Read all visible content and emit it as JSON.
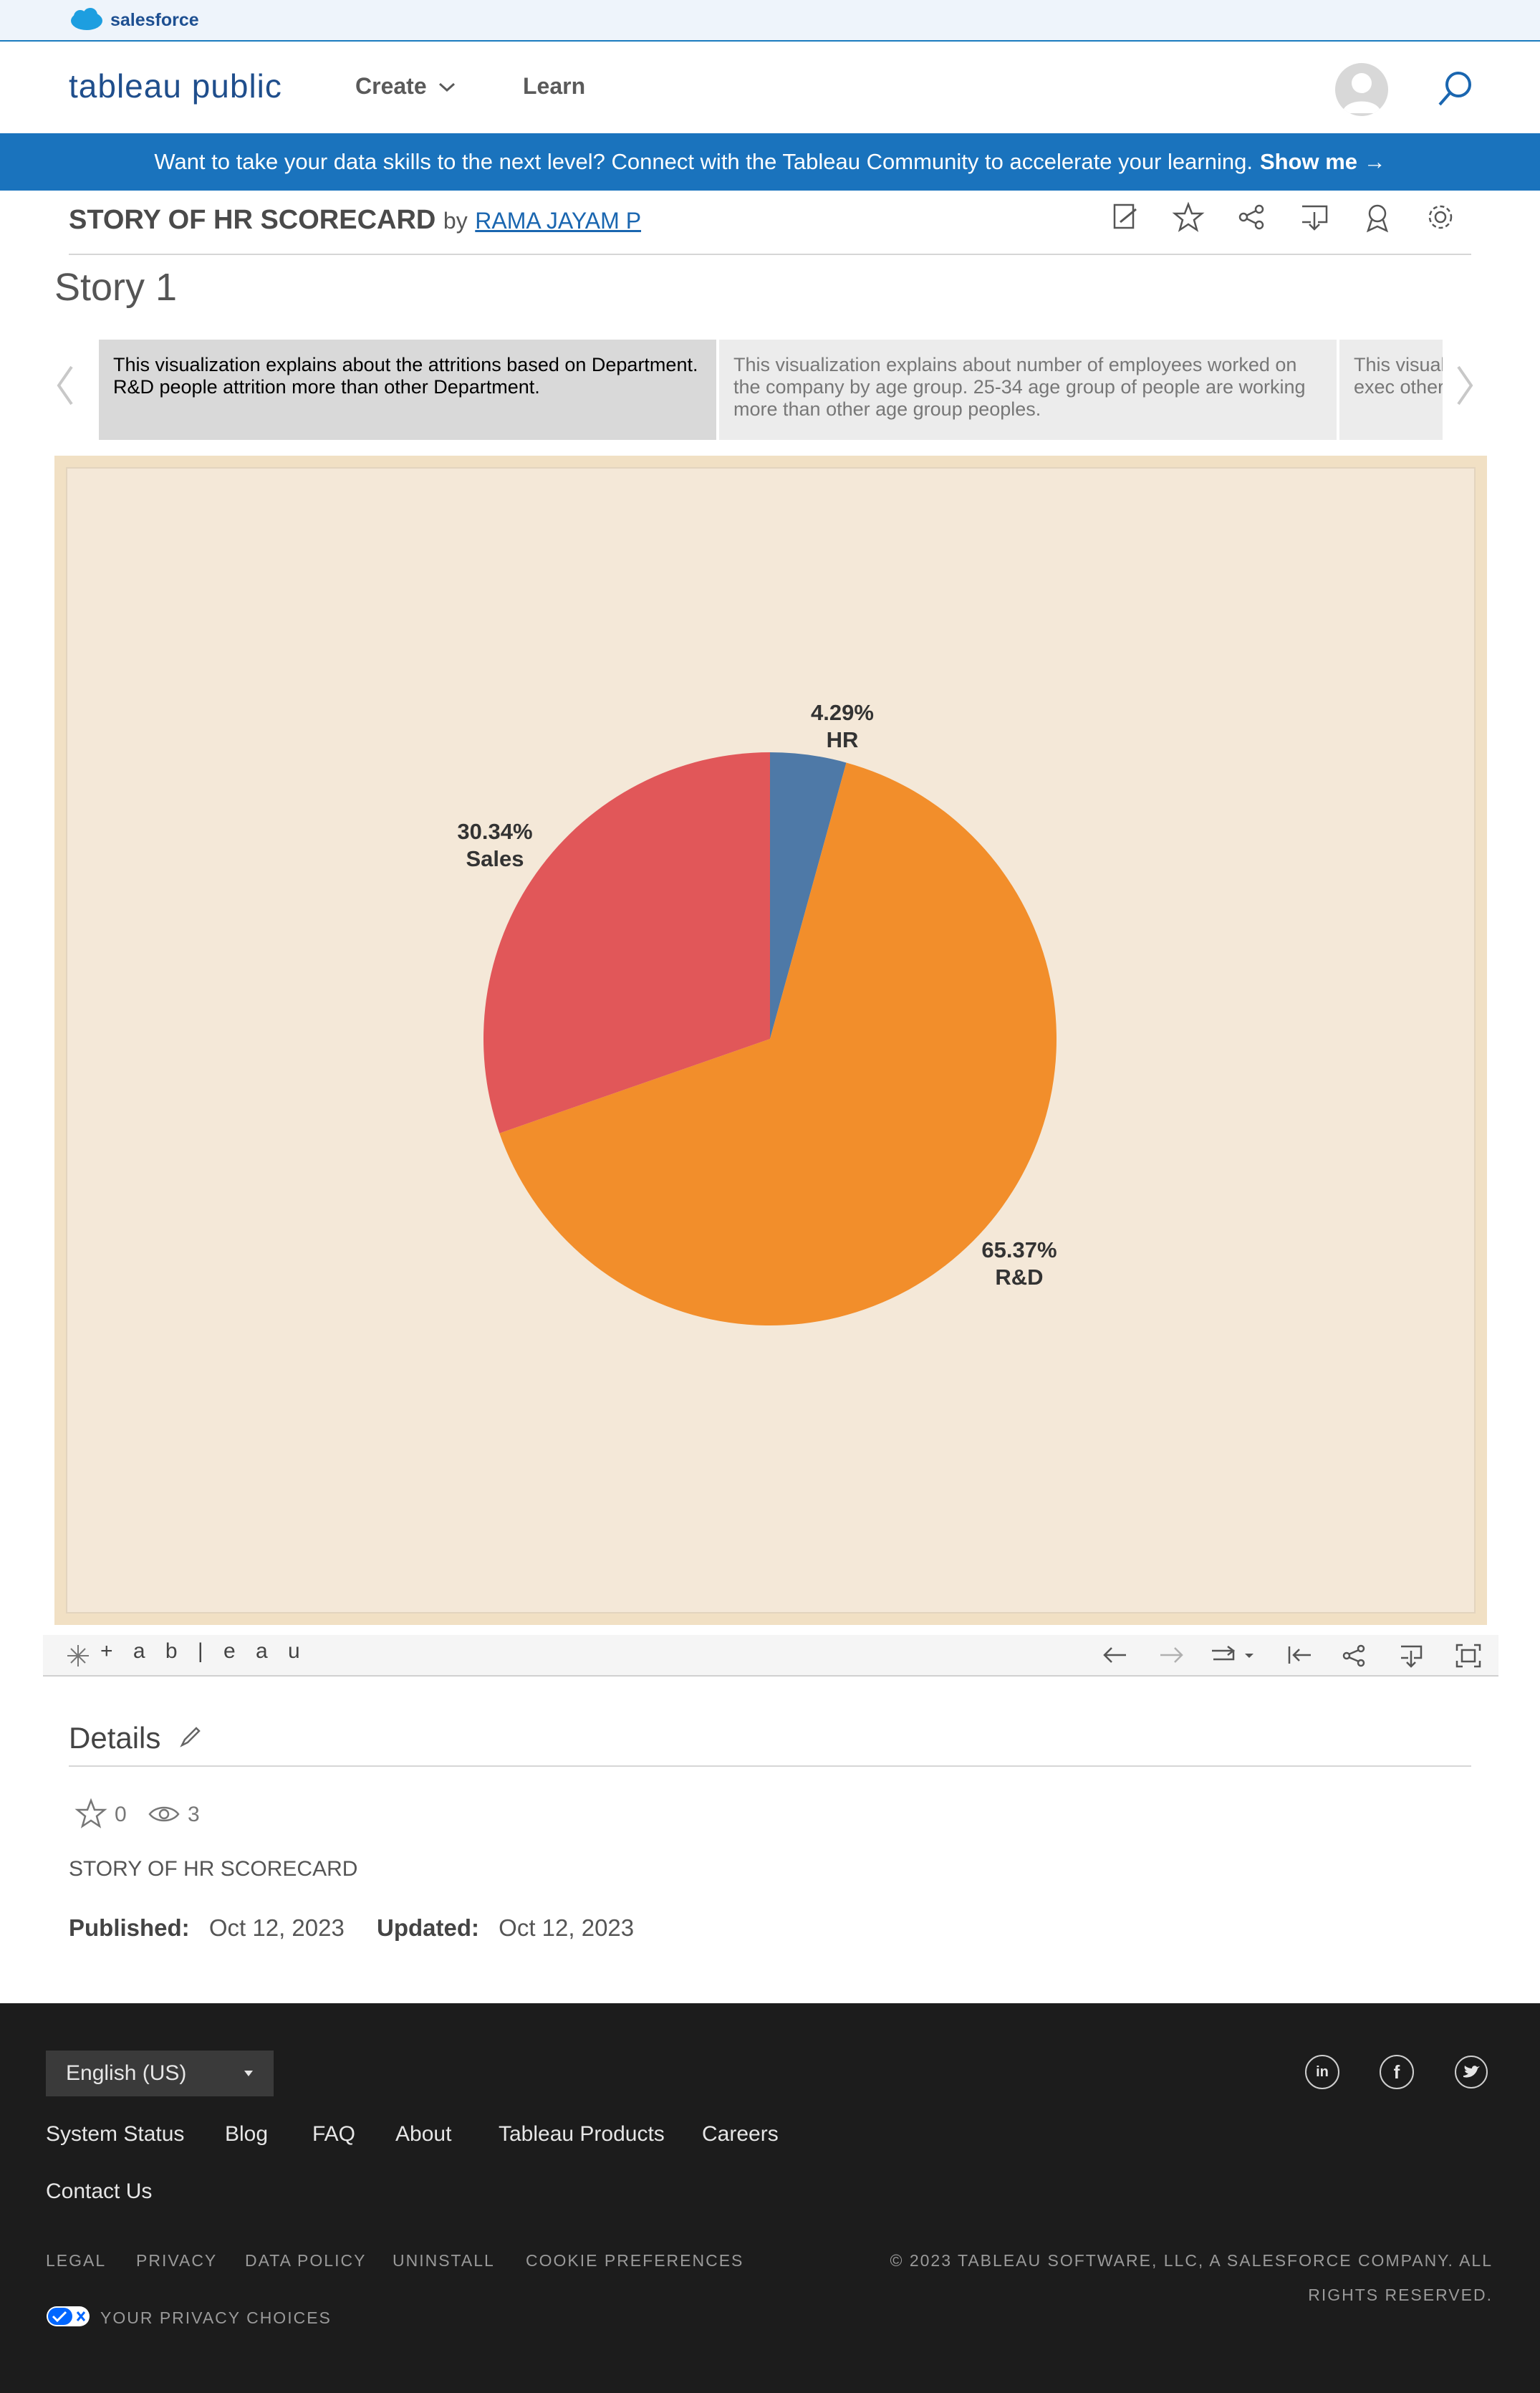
{
  "salesforce": {
    "label": "salesforce"
  },
  "brand": {
    "logo_text": "tableau public"
  },
  "nav": {
    "create": "Create",
    "learn": "Learn"
  },
  "banner": {
    "text": "Want to take your data skills to the next level? Connect with the Tableau Community to accelerate your learning.",
    "cta": "Show me →"
  },
  "viz": {
    "title": "STORY OF HR SCORECARD",
    "by": "by",
    "author": "RAMA JAYAM P"
  },
  "story": {
    "title": "Story 1",
    "points": [
      "This visualization explains about the attritions based on Department. R&D people attrition more than other Department.",
      "This visualization explains about number of employees worked on the company by age group. 25-34 age group of people are working more than other age group peoples.",
      "This visual sales exec other depa"
    ]
  },
  "chart_data": {
    "type": "pie",
    "slices": [
      {
        "label": "HR",
        "value": 4.29,
        "display": "4.29%",
        "color": "#4e79a7"
      },
      {
        "label": "R&D",
        "value": 65.37,
        "display": "65.37%",
        "color": "#f28e2b"
      },
      {
        "label": "Sales",
        "value": 30.34,
        "display": "30.34%",
        "color": "#e15759"
      }
    ]
  },
  "vizbar": {
    "tableau_label": "+ a b | e a u"
  },
  "details": {
    "title": "Details",
    "favorites": "0",
    "views": "3",
    "description": "STORY OF HR SCORECARD",
    "published_label": "Published:",
    "published_date": "Oct 12, 2023",
    "updated_label": "Updated:",
    "updated_date": "Oct 12, 2023"
  },
  "footer": {
    "language": "English (US)",
    "links": [
      "System Status",
      "Blog",
      "FAQ",
      "About",
      "Tableau Products",
      "Careers",
      "Contact Us"
    ],
    "legal": [
      "LEGAL",
      "PRIVACY",
      "DATA POLICY",
      "UNINSTALL",
      "COOKIE PREFERENCES"
    ],
    "copyright_line1": "© 2023 TABLEAU SOFTWARE, LLC, A SALESFORCE COMPANY. ALL",
    "copyright_line2": "RIGHTS RESERVED.",
    "privacy_choices": "YOUR PRIVACY CHOICES"
  }
}
